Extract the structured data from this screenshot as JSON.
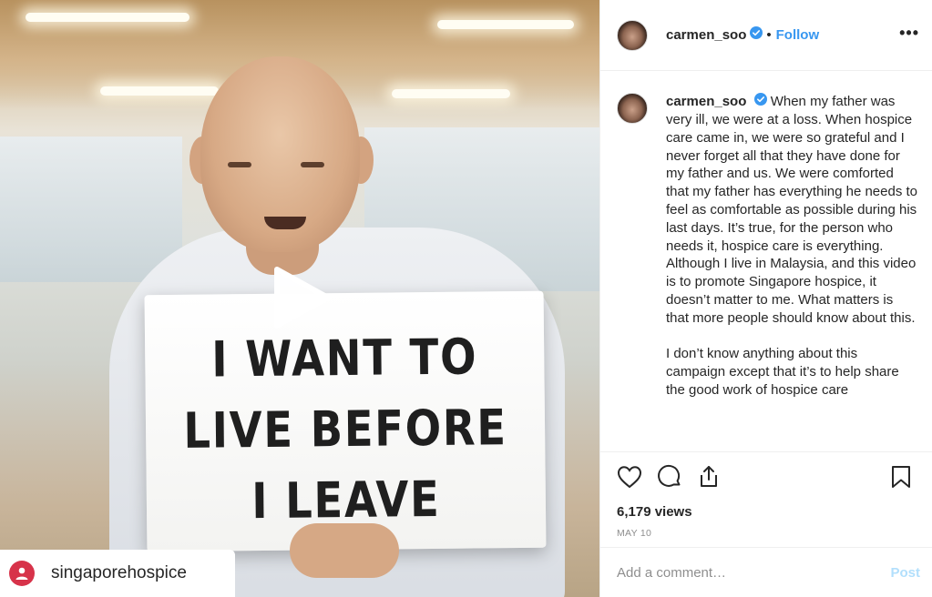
{
  "media": {
    "sign_lines": [
      "I WANT TO",
      "LIVE BEFORE",
      "I LEAVE"
    ],
    "tagged_account": "singaporehospice",
    "play_icon": "play-icon"
  },
  "post": {
    "username": "carmen_soo",
    "verified": true,
    "separator": "•",
    "follow_label": "Follow",
    "more_icon": "more-options-icon",
    "caption_paragraphs": [
      "When my father was very ill, we were at a loss. When hospice care came in, we were so grateful and I never forget all that they have done for my father and us. We were comforted that my father has everything he needs to feel as comfortable as possible during his last days. It’s true, for the person who needs it, hospice care is everything. Although I live in Malaysia, and this video is to promote Singapore hospice, it doesn’t matter to me. What matters is that more people should know about this.",
      "I don’t know anything about this campaign except that it’s to help share the good work of hospice care"
    ],
    "views": "6,179 views",
    "date": "MAY 10",
    "comment_placeholder": "Add a comment…",
    "post_label": "Post"
  },
  "colors": {
    "accent": "#3897f0",
    "post_disabled": "#b2dffc",
    "muted": "#8e8e8e",
    "text": "#262626",
    "border": "#efefef"
  }
}
